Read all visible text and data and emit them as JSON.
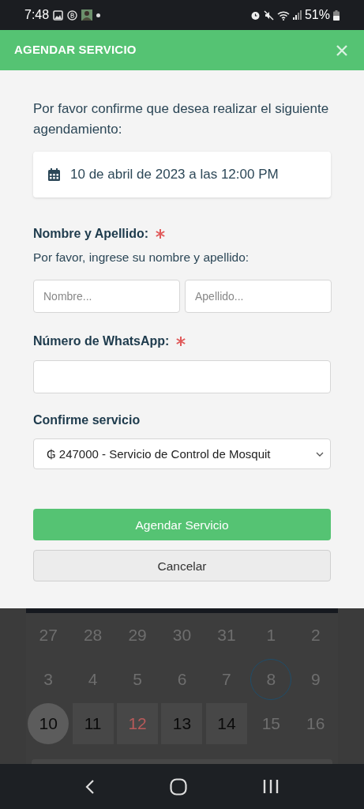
{
  "status_bar": {
    "time": "7:48",
    "battery": "51%"
  },
  "modal": {
    "title": "AGENDAR SERVICIO",
    "intro": "Por favor confirme que desea realizar el siguiente agendamiento:",
    "appointment": "10 de abril de 2023 a las 12:00 PM",
    "name_section": {
      "label": "Nombre y Apellido:",
      "required": true,
      "hint": "Por favor, ingrese su nombre y apellido:",
      "fields": [
        {
          "placeholder": "Nombre..."
        },
        {
          "placeholder": "Apellido..."
        }
      ]
    },
    "whatsapp_section": {
      "label": "Número de WhatsApp:",
      "required": true
    },
    "service_section": {
      "label": "Confirme servicio",
      "value": "₲ 247000 - Servicio de Control de Mosquit"
    },
    "buttons": [
      {
        "kind": "primary",
        "label": "Agendar Servicio"
      },
      {
        "kind": "secondary",
        "label": "Cancelar"
      }
    ]
  },
  "calendar": {
    "weeks": [
      [
        {
          "day": "27",
          "dimmed": true
        },
        {
          "day": "28",
          "dimmed": true
        },
        {
          "day": "29",
          "dimmed": true
        },
        {
          "day": "30",
          "dimmed": true
        },
        {
          "day": "31",
          "dimmed": true
        },
        {
          "day": "1",
          "dimmed": true
        },
        {
          "day": "2",
          "dimmed": true
        }
      ],
      [
        {
          "day": "3",
          "dimmed": true
        },
        {
          "day": "4",
          "dimmed": true
        },
        {
          "day": "5",
          "dimmed": true
        },
        {
          "day": "6",
          "dimmed": true
        },
        {
          "day": "7",
          "dimmed": true
        },
        {
          "day": "8",
          "dimmed": true,
          "today": true
        },
        {
          "day": "9",
          "dimmed": true
        }
      ],
      [
        {
          "day": "10",
          "dimmed": false,
          "selected": true
        },
        {
          "day": "11",
          "dimmed": false
        },
        {
          "day": "12",
          "dimmed": false,
          "holiday": true
        },
        {
          "day": "13",
          "dimmed": false
        },
        {
          "day": "14",
          "dimmed": false
        },
        {
          "day": "15",
          "dimmed": true
        },
        {
          "day": "16",
          "dimmed": true
        }
      ]
    ]
  }
}
